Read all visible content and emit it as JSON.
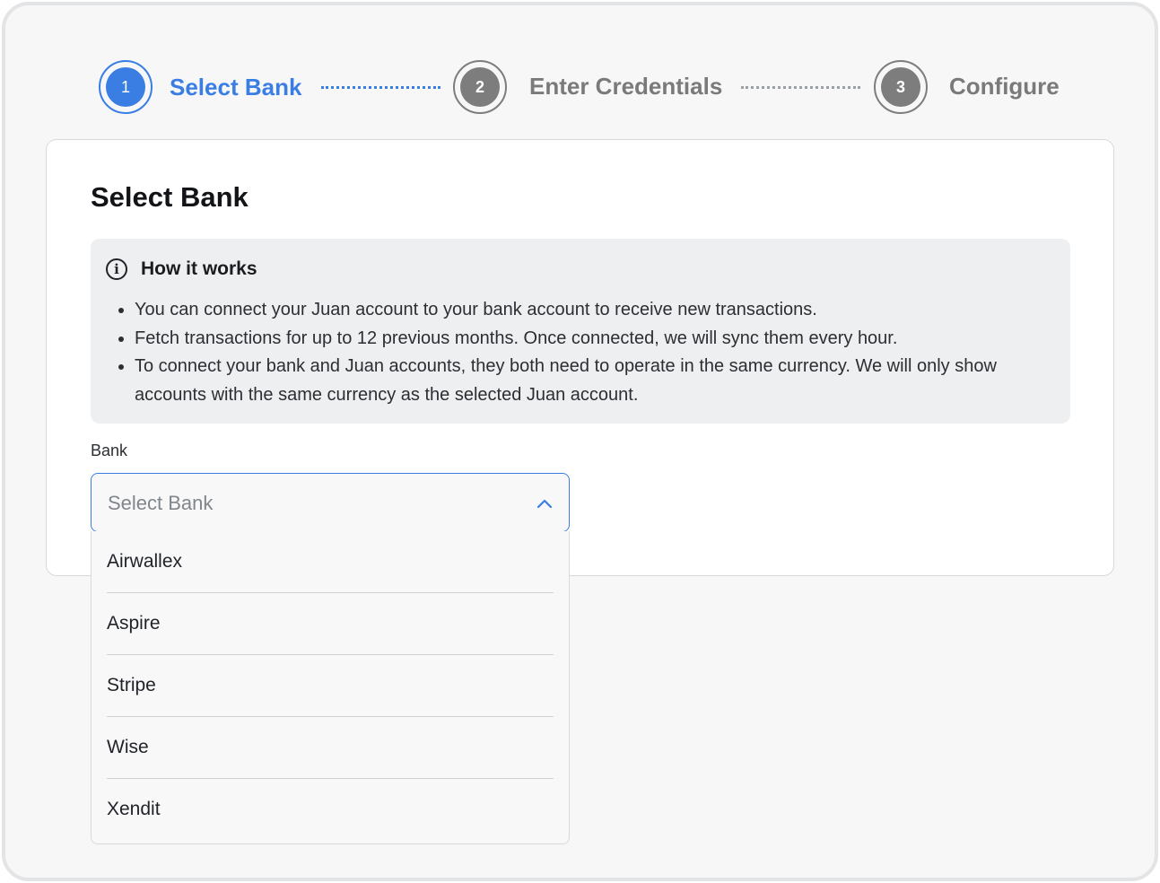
{
  "stepper": {
    "steps": [
      {
        "number": "1",
        "label": "Select Bank",
        "active": true
      },
      {
        "number": "2",
        "label": "Enter Credentials",
        "active": false
      },
      {
        "number": "3",
        "label": "Configure",
        "active": false
      }
    ]
  },
  "card": {
    "title": "Select Bank",
    "info": {
      "icon": "info-icon",
      "title": "How it works",
      "items": [
        "You can connect your Juan account to your bank account to receive new transactions.",
        "Fetch transactions for up to 12 previous months. Once connected, we will sync them every hour.",
        "To connect your bank and Juan accounts, they both need to operate in the same currency. We will only show accounts with the same currency as the selected Juan account."
      ]
    },
    "bank_field": {
      "label": "Bank",
      "placeholder": "Select Bank",
      "icon": "chevron-up-icon",
      "options": [
        "Airwallex",
        "Aspire",
        "Stripe",
        "Wise",
        "Xendit"
      ]
    }
  },
  "colors": {
    "accent": "#3a7ee4",
    "inactive": "#7d7d7d"
  }
}
